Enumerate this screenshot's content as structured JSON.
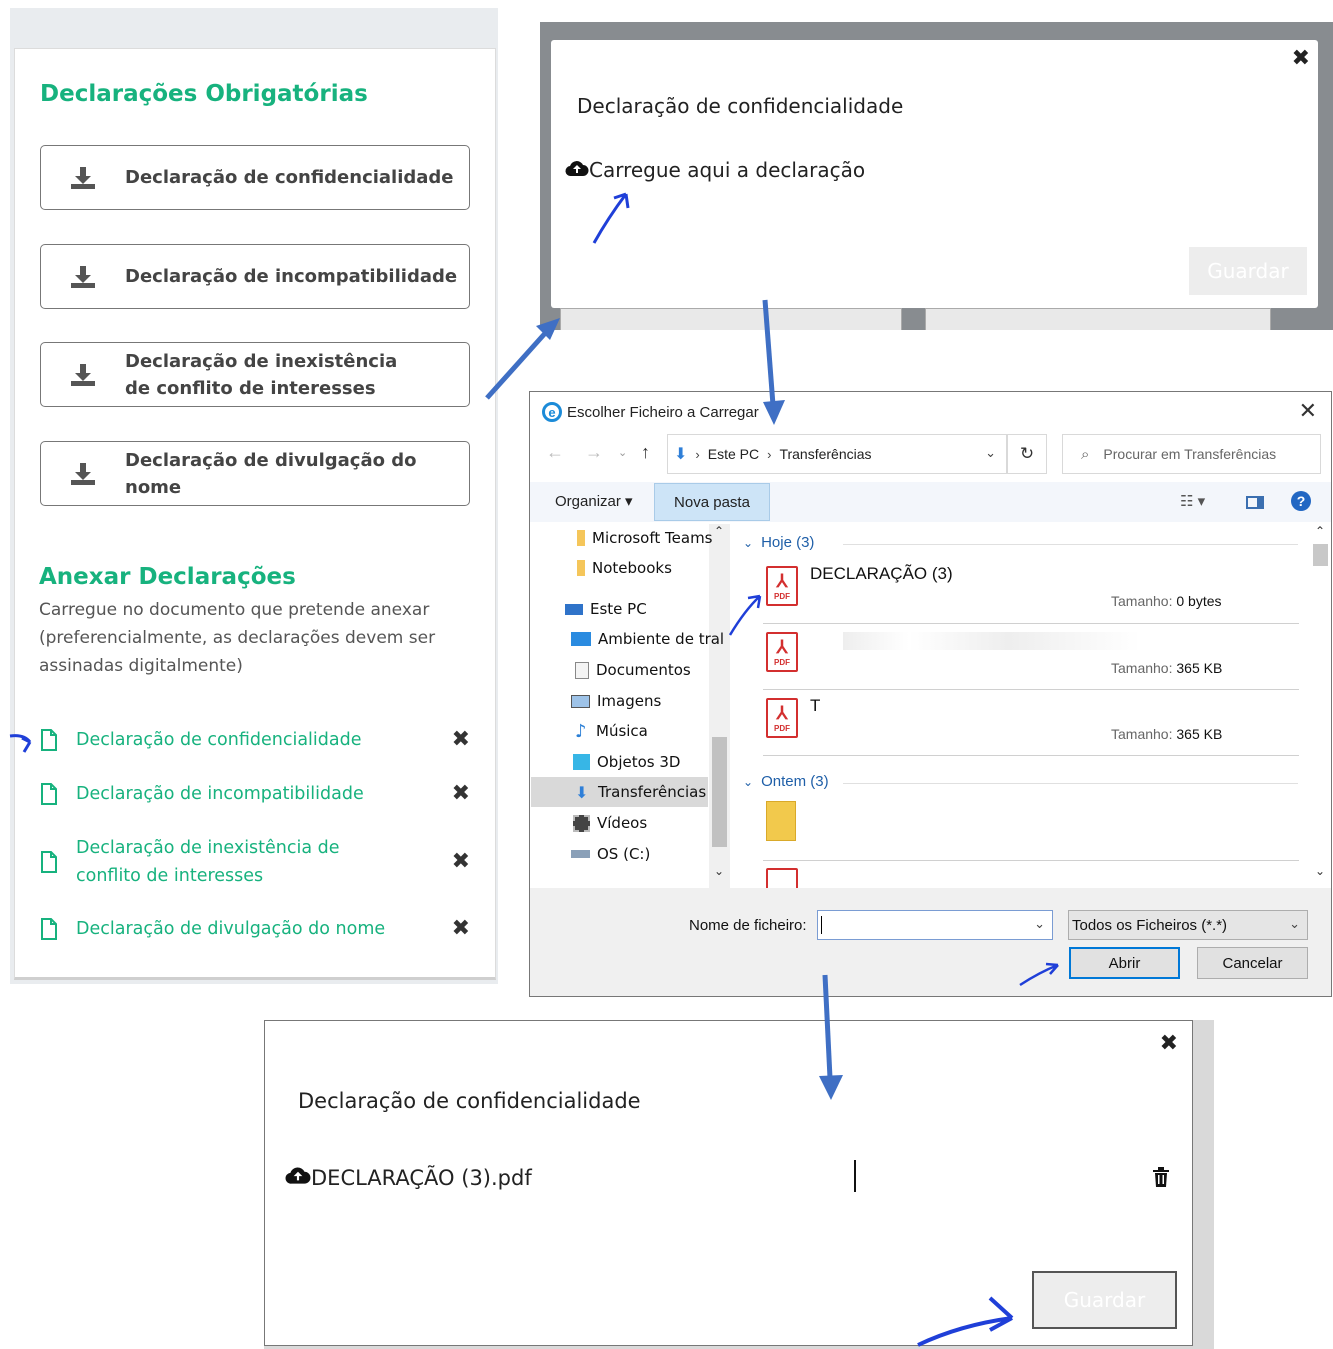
{
  "left": {
    "mandatory_title": "Declarações Obrigatórias",
    "buttons": [
      {
        "label": "Declaração de confidencialidade"
      },
      {
        "label": "Declaração de incompatibilidade"
      },
      {
        "label": "Declaração de inexistência de conflito de interesses"
      },
      {
        "label": "Declaração de divulgação do nome"
      }
    ],
    "attach_title": "Anexar Declarações",
    "attach_desc": "Carregue no documento que pretende anexar (preferencialmente, as declarações devem ser assinadas digitalmente)",
    "attachments": [
      {
        "label": "Declaração de confidencialidade"
      },
      {
        "label": "Declaração de incompatibilidade"
      },
      {
        "label": "Declaração de inexistência de conflito de interesses"
      },
      {
        "label": "Declaração de divulgação do nome"
      }
    ],
    "accent_color": "#17b27e"
  },
  "modal1": {
    "title": "Declaração de confidencialidade",
    "upload_label": "Carregue aqui a declaração",
    "save_label": "Guardar"
  },
  "dialog": {
    "title": "Escolher Ficheiro a Carregar",
    "path": [
      "Este PC",
      "Transferências"
    ],
    "search_placeholder": "Procurar em Transferências",
    "organize_label": "Organizar",
    "new_folder_label": "Nova pasta",
    "nav_items": [
      {
        "label": "Microsoft Teams",
        "icon": "folder-icon"
      },
      {
        "label": "Notebooks",
        "icon": "folder-icon"
      },
      {
        "label": "Este PC",
        "icon": "computer-icon"
      },
      {
        "label": "Ambiente de tral",
        "icon": "desktop-icon"
      },
      {
        "label": "Documentos",
        "icon": "documents-icon"
      },
      {
        "label": "Imagens",
        "icon": "images-icon"
      },
      {
        "label": "Música",
        "icon": "music-icon"
      },
      {
        "label": "Objetos 3D",
        "icon": "cube-icon"
      },
      {
        "label": "Transferências",
        "icon": "download-icon"
      },
      {
        "label": "Vídeos",
        "icon": "video-icon"
      },
      {
        "label": "OS (C:)",
        "icon": "drive-icon"
      }
    ],
    "group_today": "Hoje (3)",
    "group_yesterday": "Ontem (3)",
    "files_today": [
      {
        "name": "DECLARAÇÃO (3)",
        "size_label": "Tamanho:",
        "size": "0 bytes"
      },
      {
        "name": "",
        "size_label": "Tamanho:",
        "size": "365 KB"
      },
      {
        "name": "T",
        "size_label": "Tamanho:",
        "size": "365 KB"
      }
    ],
    "filename_label": "Nome de ficheiro:",
    "filename_value": "",
    "filter_value": "Todos os Ficheiros (*.*)",
    "open_label": "Abrir",
    "cancel_label": "Cancelar"
  },
  "modal2": {
    "title": "Declaração de confidencialidade",
    "file_name": "DECLARAÇÃO (3).pdf",
    "save_label": "Guardar"
  }
}
